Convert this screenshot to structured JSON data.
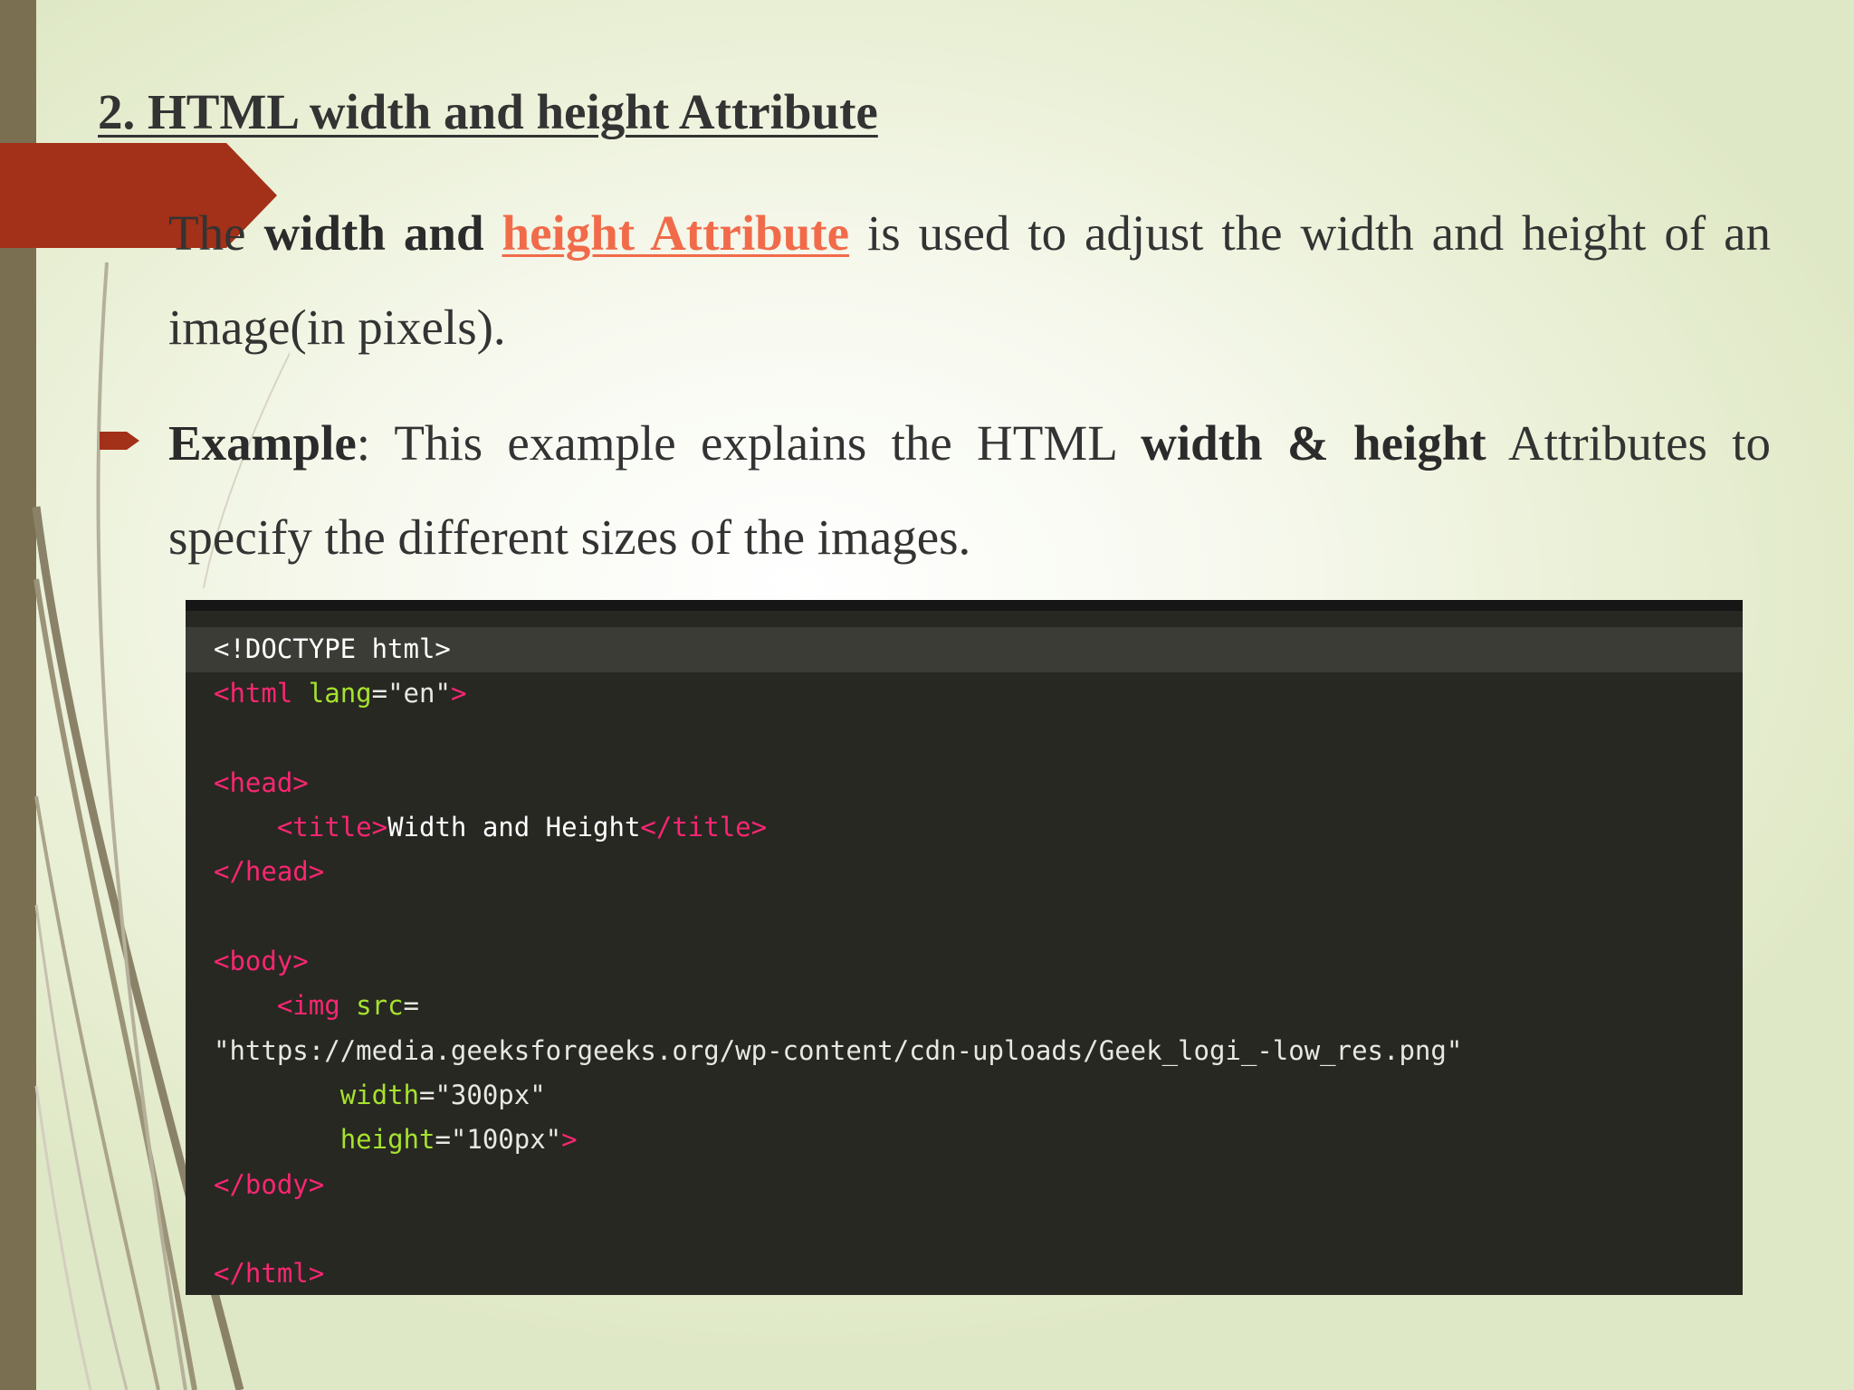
{
  "slide": {
    "title": "2. HTML width and height Attribute",
    "paragraph1": {
      "word_the": "The",
      "bold_text": "width and",
      "link_text": "height Attribute",
      "rest_text": "is used to adjust the width and height of an image(in pixels)."
    },
    "paragraph2": {
      "label": "Example",
      "colon": ":",
      "text_before": "This example explains the HTML",
      "bold_width": "width",
      "amp": "&",
      "bold_height": "height",
      "text_after": "Attributes to specify the different sizes of the images."
    }
  },
  "code": {
    "l1": "<!DOCTYPE html>",
    "l2_tag": "<html",
    "l2_attr": "lang",
    "l2_eq": "=",
    "l2_val": "\"en\"",
    "l2_end": ">",
    "l4": "<head>",
    "l5_indent": "    ",
    "l5_open": "<title>",
    "l5_text": "Width and Height",
    "l5_close": "</title>",
    "l6": "</head>",
    "l8": "<body>",
    "l9_indent": "    ",
    "l9_tag": "<img",
    "l9_attr": "src",
    "l9_eq": "=",
    "l10": "\"https://media.geeksforgeeks.org/wp-content/cdn-uploads/Geek_logi_-low_res.png\"",
    "l11_indent": "        ",
    "l11_attr": "width",
    "l11_eq": "=",
    "l11_val": "\"300px\"",
    "l12_indent": "        ",
    "l12_attr": "height",
    "l12_eq": "=",
    "l12_val": "\"100px\"",
    "l12_end": ">",
    "l13": "</body>",
    "l15": "</html>"
  },
  "colors": {
    "accent_arrow": "#a33018",
    "left_band": "#7a6f50",
    "link": "#f16b4a",
    "code_bg": "#272822",
    "code_tag": "#f92672",
    "code_attr": "#a6e22e"
  },
  "icons": {
    "bullet": "arrow-bullet-icon"
  }
}
